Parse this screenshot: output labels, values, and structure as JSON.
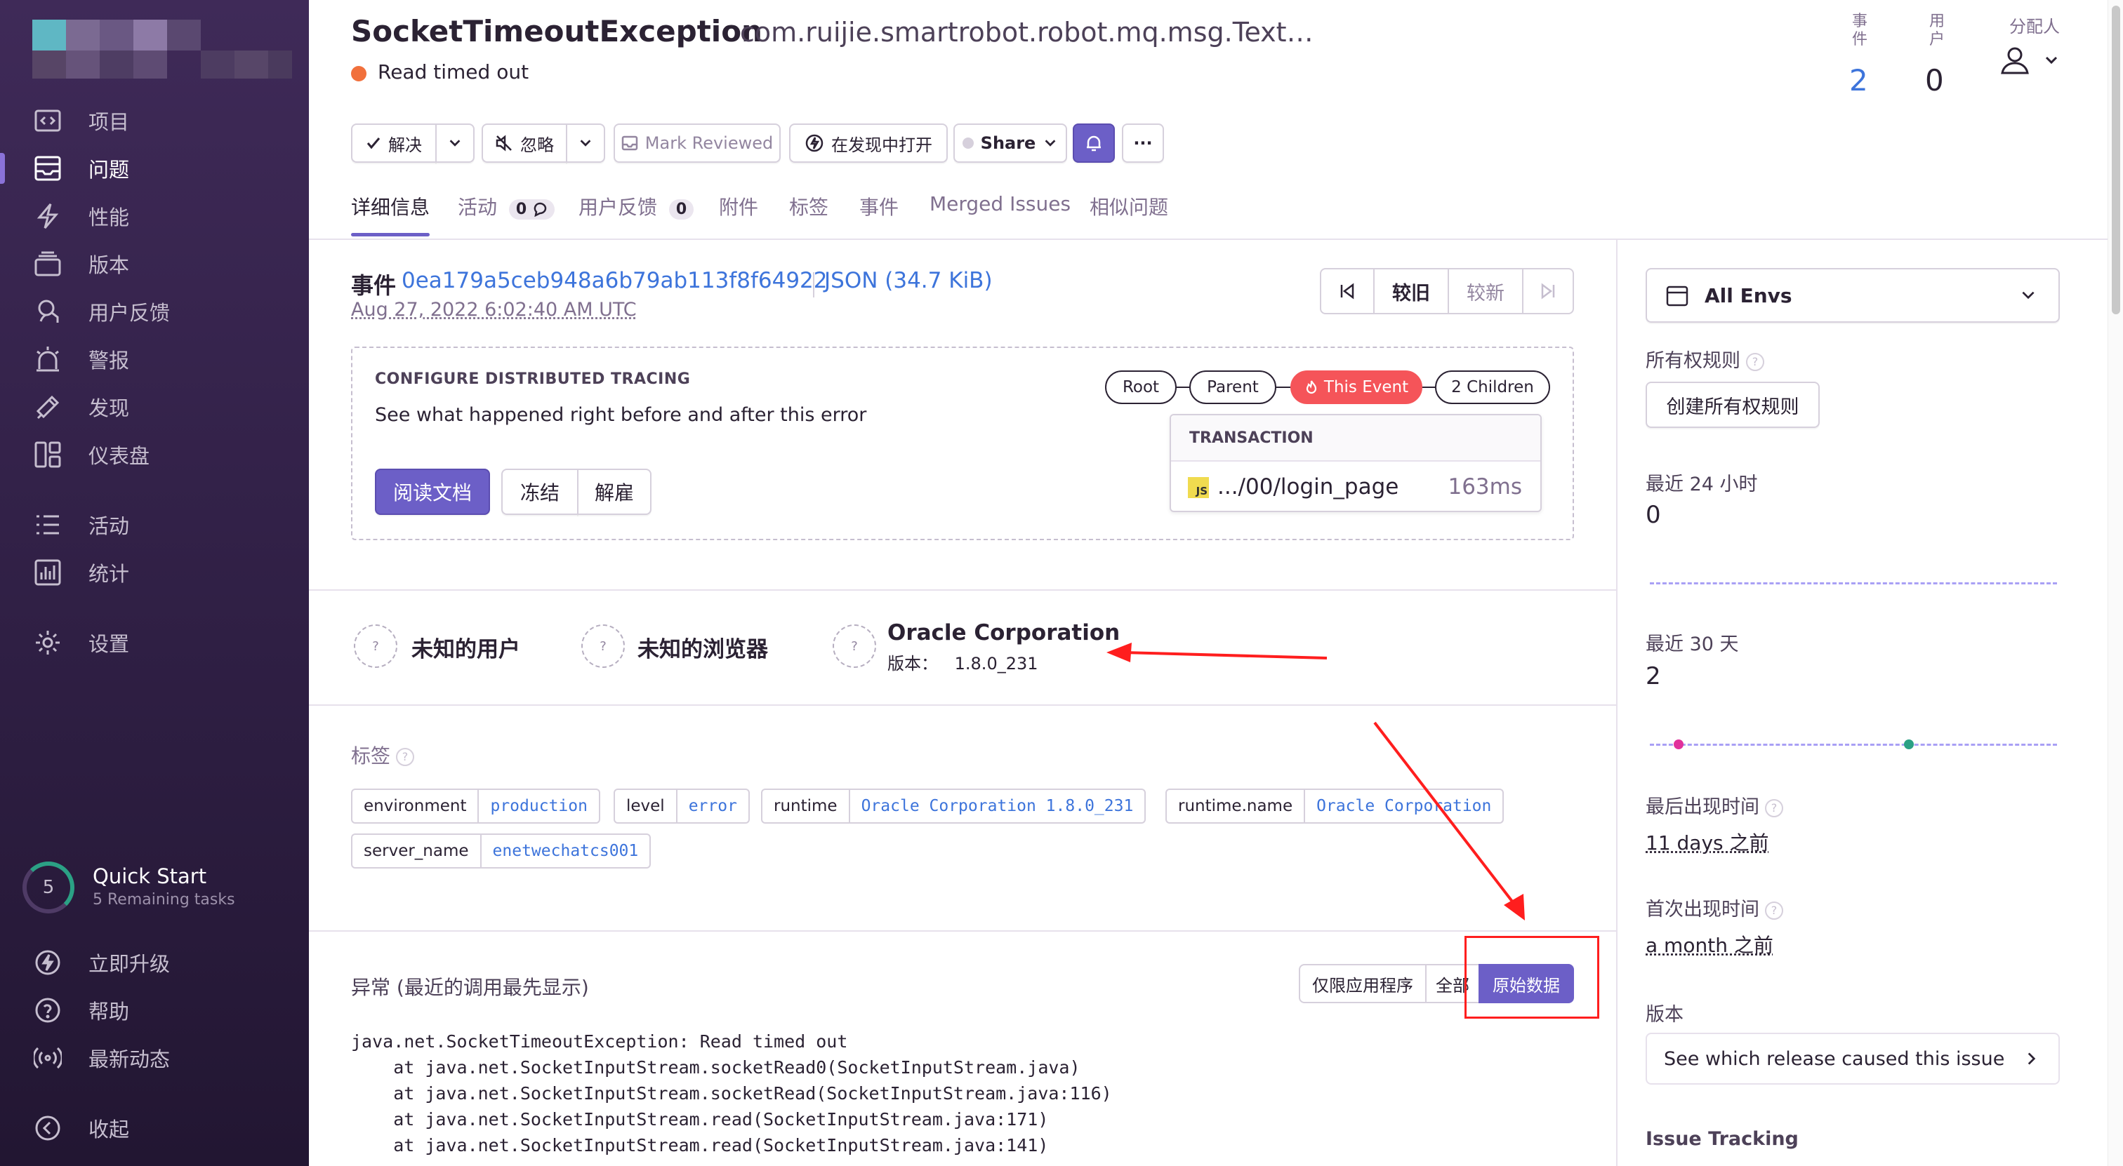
{
  "sidebar": {
    "items": [
      {
        "label": "项目",
        "icon": "project-icon"
      },
      {
        "label": "问题",
        "icon": "issues-icon"
      },
      {
        "label": "性能",
        "icon": "performance-icon"
      },
      {
        "label": "版本",
        "icon": "releases-icon"
      },
      {
        "label": "用户反馈",
        "icon": "user-feedback-icon"
      },
      {
        "label": "警报",
        "icon": "alerts-icon"
      },
      {
        "label": "发现",
        "icon": "discover-icon"
      },
      {
        "label": "仪表盘",
        "icon": "dashboards-icon"
      },
      {
        "label": "活动",
        "icon": "activity-icon"
      },
      {
        "label": "统计",
        "icon": "stats-icon"
      },
      {
        "label": "设置",
        "icon": "settings-icon"
      }
    ],
    "quick_start": {
      "count": "5",
      "title": "Quick Start",
      "subtitle": "5 Remaining tasks"
    },
    "bottom": [
      {
        "label": "立即升级",
        "icon": "upgrade-icon"
      },
      {
        "label": "帮助",
        "icon": "help-icon"
      },
      {
        "label": "最新动态",
        "icon": "broadcast-icon"
      },
      {
        "label": "收起",
        "icon": "collapse-icon"
      }
    ]
  },
  "issue": {
    "title": "SocketTimeoutException",
    "culprit": "com.ruijie.smartrobot.robot.mq.msg.TextCo…",
    "message": "Read timed out",
    "status_color": "#f1703c"
  },
  "stats": {
    "events_label": "事件",
    "events_value": "2",
    "users_label": "用户",
    "users_value": "0",
    "assignee_label": "分配人"
  },
  "actions": {
    "resolve": "解决",
    "ignore": "忽略",
    "mark_reviewed": "Mark Reviewed",
    "open_in_discover": "在发现中打开",
    "share": "Share",
    "more": "···"
  },
  "tabs": [
    {
      "label": "详细信息"
    },
    {
      "label": "活动",
      "badge": "0"
    },
    {
      "label": "用户反馈",
      "badge": "0"
    },
    {
      "label": "附件"
    },
    {
      "label": "标签"
    },
    {
      "label": "事件"
    },
    {
      "label": "Merged Issues"
    },
    {
      "label": "相似问题"
    }
  ],
  "event": {
    "label": "事件",
    "id": "0ea179a5ceb948a6b79ab113f8f64922",
    "json": "JSON (34.7 KiB)",
    "date": "Aug 27, 2022 6:02:40 AM UTC",
    "older": "较旧",
    "newer": "较新"
  },
  "tracing": {
    "title": "CONFIGURE DISTRIBUTED TRACING",
    "description": "See what happened right before and after this error",
    "read_docs": "阅读文档",
    "snooze": "冻结",
    "dismiss": "解雇",
    "nodes": [
      "Root",
      "Parent",
      "This Event",
      "2 Children"
    ],
    "transaction_header": "TRANSACTION",
    "transaction_badge": "JS",
    "transaction_name": ".../00/login_page",
    "transaction_duration": "163ms"
  },
  "context": {
    "user": "未知的用户",
    "browser": "未知的浏览器",
    "runtime_name": "Oracle Corporation",
    "runtime_version_label": "版本：",
    "runtime_version": "1.8.0_231",
    "unknown_glyph": "?"
  },
  "tags_section": {
    "title": "标签",
    "tags": [
      {
        "key": "environment",
        "value": "production"
      },
      {
        "key": "level",
        "value": "error"
      },
      {
        "key": "runtime",
        "value": "Oracle Corporation 1.8.0_231"
      },
      {
        "key": "runtime.name",
        "value": "Oracle Corporation"
      },
      {
        "key": "server_name",
        "value": "enetwechatcs001"
      }
    ]
  },
  "exception": {
    "title": "异常 (最近的调用最先显示)",
    "toggles": [
      "仅限应用程序",
      "全部",
      "原始数据"
    ],
    "active_toggle": "原始数据",
    "stacktrace": "java.net.SocketTimeoutException: Read timed out\n    at java.net.SocketInputStream.socketRead0(SocketInputStream.java)\n    at java.net.SocketInputStream.socketRead(SocketInputStream.java:116)\n    at java.net.SocketInputStream.read(SocketInputStream.java:171)\n    at java.net.SocketInputStream.read(SocketInputStream.java:141)"
  },
  "side": {
    "env": "All Envs",
    "ownership_title": "所有权规则",
    "ownership_button": "创建所有权规则",
    "last24_title": "最近 24 小时",
    "last24_value": "0",
    "last30_title": "最近 30 天",
    "last30_value": "2",
    "last_seen_title": "最后出现时间",
    "last_seen_value": "11 days 之前",
    "first_seen_title": "首次出现时间",
    "first_seen_value": "a month 之前",
    "release_title": "版本",
    "release_cta": "See which release caused this issue",
    "issue_tracking_title": "Issue Tracking"
  },
  "colors": {
    "sidebar_bg": "#3f2a58",
    "accent": "#6c5fc7",
    "link": "#3d74db",
    "current_event": "#f55459",
    "annotation": "#ff1e1e"
  }
}
